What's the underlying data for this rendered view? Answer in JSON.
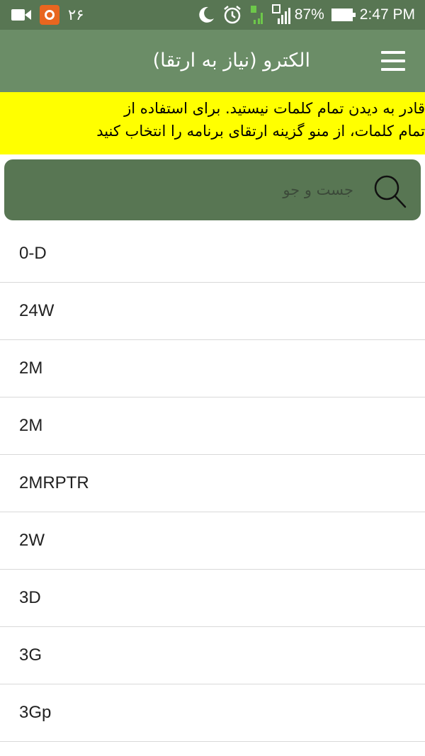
{
  "status_bar": {
    "notification_count": "۲۶",
    "battery": "87%",
    "time": "2:47 PM",
    "sim1_label": "1",
    "sim2_label": "2"
  },
  "app_bar": {
    "title": "الکترو (نیاز به ارتقا)",
    "menu_icon": "hamburger-menu-icon"
  },
  "banner": {
    "line1": "قادر به دیدن تمام کلمات نیستید. برای استفاده از",
    "line2": "تمام کلمات، از منو گزینه ارتقای برنامه را انتخاب کنید"
  },
  "search": {
    "placeholder": "جست و جو",
    "icon": "search-icon"
  },
  "words": [
    "0-D",
    "24W",
    "2M",
    "2M",
    "2MRPTR",
    "2W",
    "3D",
    "3G",
    "3Gp"
  ],
  "colors": {
    "status_bar": "#587653",
    "app_bar": "#6b8d67",
    "banner": "#ffff00",
    "search_box": "#587653"
  }
}
